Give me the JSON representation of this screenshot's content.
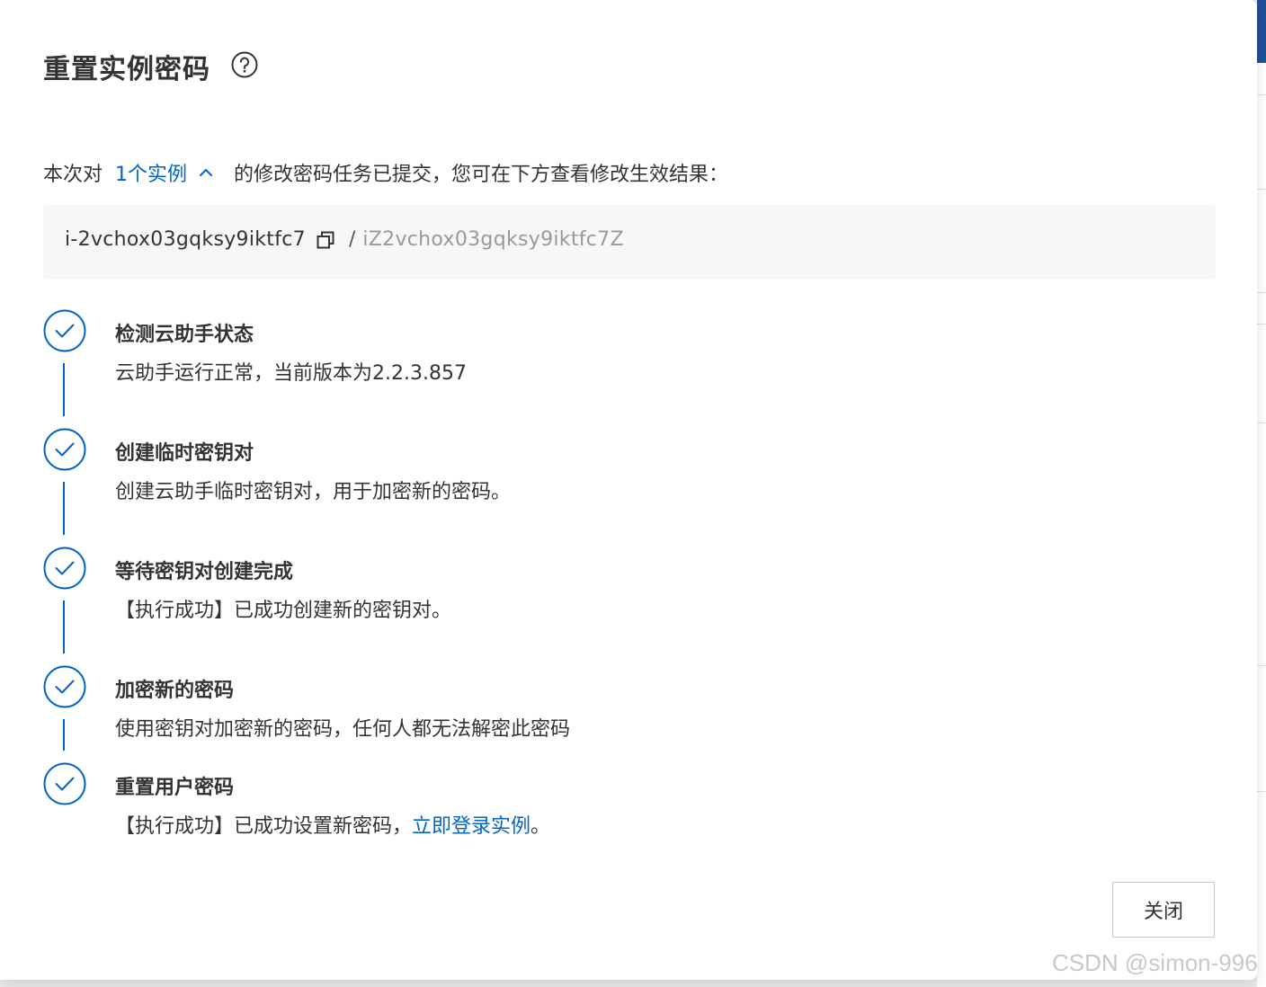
{
  "dialog": {
    "title": "重置实例密码",
    "summary_prefix": "本次对",
    "summary_link": "1个实例",
    "summary_suffix": "的修改密码任务已提交，您可在下方查看修改生效结果：",
    "instance_id": "i-2vchox03gqksy9iktfc7",
    "separator": "/",
    "host_name": "iZ2vchox03gqksy9iktfc7Z",
    "steps": [
      {
        "title": "检测云助手状态",
        "desc": "云助手运行正常，当前版本为2.2.3.857"
      },
      {
        "title": "创建临时密钥对",
        "desc": "创建云助手临时密钥对，用于加密新的密码。"
      },
      {
        "title": "等待密钥对创建完成",
        "desc": "【执行成功】已成功创建新的密钥对。"
      },
      {
        "title": "加密新的密码",
        "desc": "使用密钥对加密新的密码，任何人都无法解密此密码"
      },
      {
        "title": "重置用户密码",
        "desc": "【执行成功】已成功设置新密码，",
        "desc_link": "立即登录实例",
        "desc_end": "。"
      }
    ],
    "close_label": "关闭"
  },
  "watermark": "CSDN @simon-996",
  "colors": {
    "accent": "#0064c8",
    "panel": "#f6f7f8"
  }
}
